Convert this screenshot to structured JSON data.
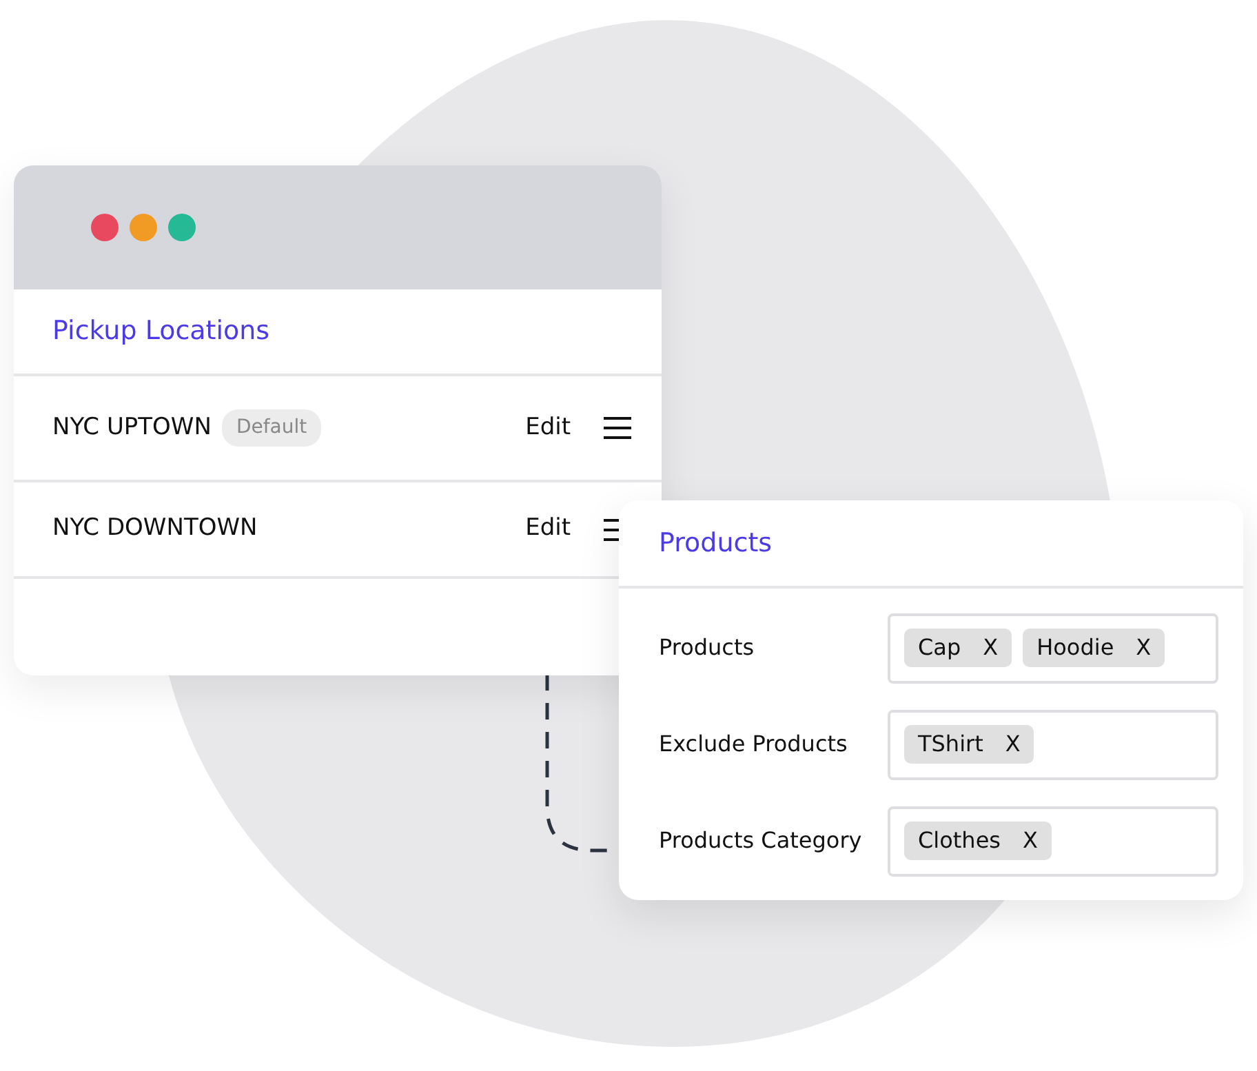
{
  "locations_window": {
    "window_controls": [
      {
        "color": "#e9495e"
      },
      {
        "color": "#f29b24"
      },
      {
        "color": "#25b996"
      }
    ],
    "title": "Pickup Locations",
    "rows": [
      {
        "name": "NYC UPTOWN",
        "badge": "Default",
        "action": "Edit"
      },
      {
        "name": "NYC DOWNTOWN",
        "action": "Edit"
      }
    ]
  },
  "products_panel": {
    "title": "Products",
    "fields": [
      {
        "label": "Products",
        "tags": [
          {
            "label": "Cap",
            "remove": "X"
          },
          {
            "label": "Hoodie",
            "remove": "X"
          }
        ]
      },
      {
        "label": "Exclude Products",
        "tags": [
          {
            "label": "TShirt",
            "remove": "X"
          }
        ]
      },
      {
        "label": "Products Category",
        "tags": [
          {
            "label": "Clothes",
            "remove": "X"
          }
        ]
      }
    ]
  }
}
